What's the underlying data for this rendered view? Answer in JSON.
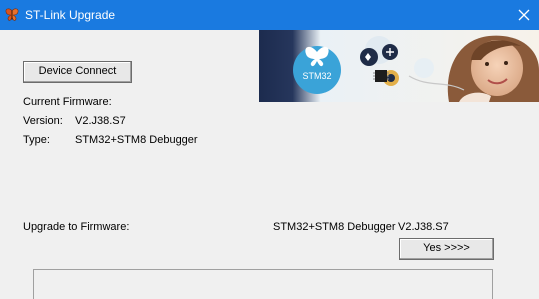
{
  "window": {
    "title": "ST-Link Upgrade",
    "titlebar_color": "#1a7ae0",
    "app_icon": "butterfly-icon",
    "close_icon": "close-icon"
  },
  "banner": {
    "logo_text": "STM32"
  },
  "buttons": {
    "device_connect": "Device Connect",
    "yes": "Yes >>>>"
  },
  "firmware": {
    "current_label": "Current Firmware:",
    "version_label": "Version:",
    "version_value": "V2.J38.S7",
    "type_label": "Type:",
    "type_value": "STM32+STM8 Debugger"
  },
  "upgrade": {
    "label": "Upgrade to Firmware:",
    "type_value": "STM32+STM8 Debugger",
    "version_value": "V2.J38.S7"
  }
}
